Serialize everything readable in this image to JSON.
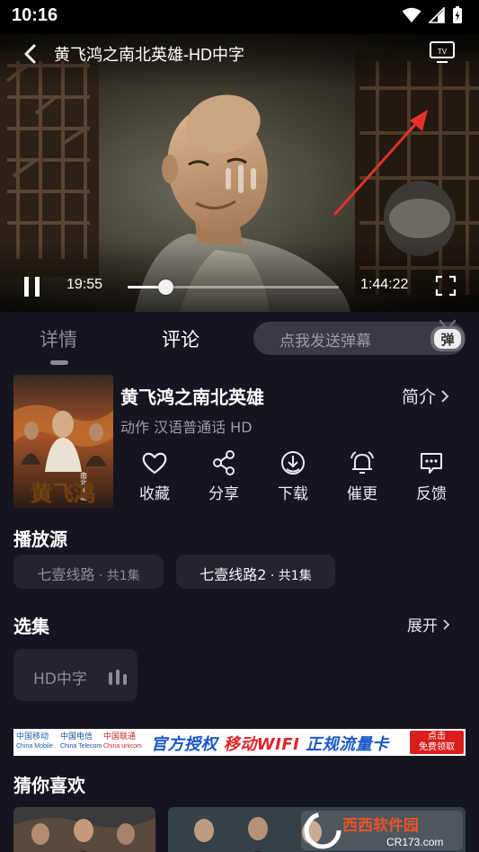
{
  "status_bar": {
    "time": "10:16"
  },
  "player": {
    "title": "黄飞鸿之南北英雄-HD中字",
    "current_time": "19:55",
    "total_time": "1:44:22",
    "progress": 0.18,
    "tv_label": "TV"
  },
  "tabs": {
    "details": "详情",
    "comments": "评论",
    "danmaku_placeholder": "点我发送弹幕",
    "danmaku_icon_text": "弹"
  },
  "movie": {
    "title": "黄飞鸿之南北英雄",
    "meta": "动作 汉语普通话 HD",
    "intro": "简介",
    "poster_text": "黄飞鸿",
    "poster_subtitle": "南北英雄"
  },
  "actions": [
    {
      "label": "收藏",
      "icon": "heart-icon"
    },
    {
      "label": "分享",
      "icon": "share-icon"
    },
    {
      "label": "下载",
      "icon": "download-icon"
    },
    {
      "label": "催更",
      "icon": "bell-icon"
    },
    {
      "label": "反馈",
      "icon": "feedback-icon"
    }
  ],
  "sources": {
    "title": "播放源",
    "items": [
      {
        "name": "七壹线路",
        "count": " · 共1集"
      },
      {
        "name": "七壹线路2",
        "count": " · 共1集"
      }
    ]
  },
  "episodes": {
    "title": "选集",
    "expand": "展开",
    "items": [
      {
        "label": "HD中字"
      }
    ]
  },
  "ad": {
    "logo1": "中国移动",
    "logo1_en": "China Mobile",
    "logo2": "中国电信",
    "logo2_en": "China Telecom",
    "logo3": "中国联通",
    "logo3_en": "China unicom",
    "text_blue1": "官方授权 ",
    "text_red1": "移动WIFI",
    "text_blue2": " 正规流量卡",
    "cta_line1": "点击",
    "cta_line2": "免费领取"
  },
  "recommend": {
    "title": "猜你喜欢"
  },
  "watermark": {
    "brand": "西西软件园",
    "url": "CR173.com"
  },
  "colors": {
    "background": "#15151f",
    "accent": "#e0262a",
    "card": "#24242e"
  }
}
